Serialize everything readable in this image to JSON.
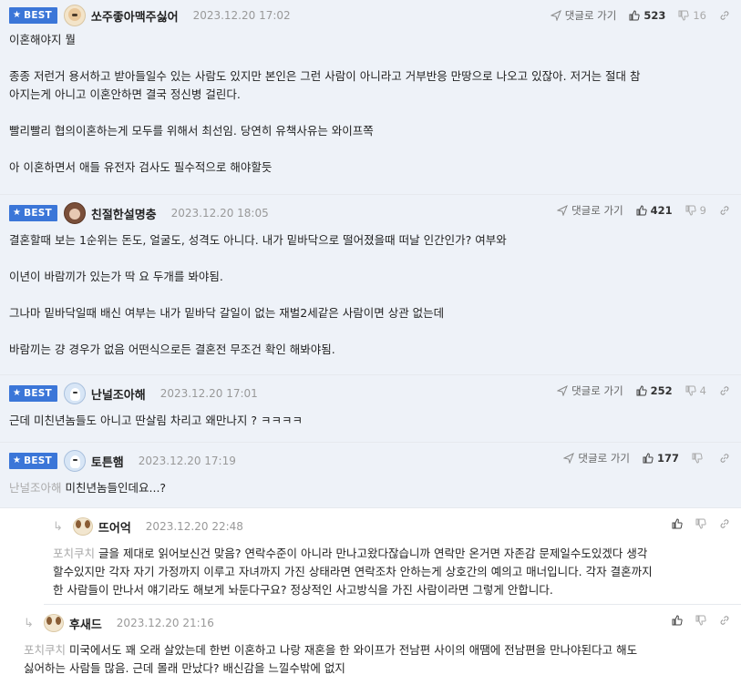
{
  "labels": {
    "best": "BEST",
    "reply_to": "댓글로 가기"
  },
  "comments": [
    {
      "nick": "쏘주좋아맥주싫어",
      "date": "2023.12.20 17:02",
      "up": "523",
      "down": "16",
      "lines": [
        "이혼해야지 뭘",
        "",
        "종종 저런거 용서하고 받아들일수 있는 사람도 있지만 본인은 그런 사람이 아니라고 거부반응 만땅으로 나오고 있잖아. 저거는 절대 참",
        "아지는게 아니고 이혼안하면 결국 정신병 걸린다.",
        "",
        "빨리빨리 협의이혼하는게 모두를 위해서 최선임. 당연히 유책사유는 와이프쪽",
        "",
        "아 이혼하면서 애들 유전자 검사도 필수적으로 해야할듯"
      ]
    },
    {
      "nick": "친절한설명충",
      "date": "2023.12.20 18:05",
      "up": "421",
      "down": "9",
      "lines": [
        "결혼할때 보는 1순위는 돈도, 얼굴도, 성격도 아니다. 내가 밑바닥으로 떨어졌을때 떠날 인간인가? 여부와",
        "",
        "이년이 바람끼가 있는가 딱 요 두개를 봐야됨.",
        "",
        "그나마 밑바닥일때 배신 여부는 내가 밑바닥 갈일이 없는 재벌2세같은 사람이면 상관 없는데",
        "",
        "바람끼는 걍 경우가 없음 어떤식으로든 결혼전 무조건 확인 해봐야됨."
      ]
    },
    {
      "nick": "난널조아해",
      "date": "2023.12.20 17:01",
      "up": "252",
      "down": "4",
      "lines": [
        "근데 미친년놈들도 아니고 딴살림 차리고 왜만나지 ? ㅋㅋㅋㅋ"
      ]
    },
    {
      "nick": "토튼햄",
      "date": "2023.12.20 17:19",
      "up": "177",
      "down": "",
      "mention": "난널조아해",
      "lines": [
        "미친년놈들인데요...?"
      ]
    }
  ],
  "replies": [
    {
      "nick": "뜨어억",
      "date": "2023.12.20 22:48",
      "mention": "포치쿠치",
      "lines": [
        "글을 제대로 읽어보신건 맞음? 연락수준이 아니라 만나고왔다잖습니까 연락만 온거면 자존감 문제일수도있겠다 생각",
        "할수있지만 각자 자기 가정까지 이루고 자녀까지 가진 상태라면 연락조차 안하는게 상호간의 예의고 매너입니다. 각자 결혼까지",
        "한 사람들이 만나서 얘기라도 해보게 놔둔다구요? 정상적인 사고방식을 가진 사람이라면 그렇게 안합니다."
      ]
    },
    {
      "nick": "후새드",
      "date": "2023.12.20 21:16",
      "mention": "포치쿠치",
      "lines": [
        "미국에서도 꽤 오래 살았는데 한번 이혼하고 나랑 재혼을 한 와이프가 전남편 사이의 애땜에 전남편을 만나야된다고 해도",
        "싫어하는 사람들 많음. 근데 몰래 만났다? 배신감을 느낄수밖에 없지"
      ]
    }
  ]
}
